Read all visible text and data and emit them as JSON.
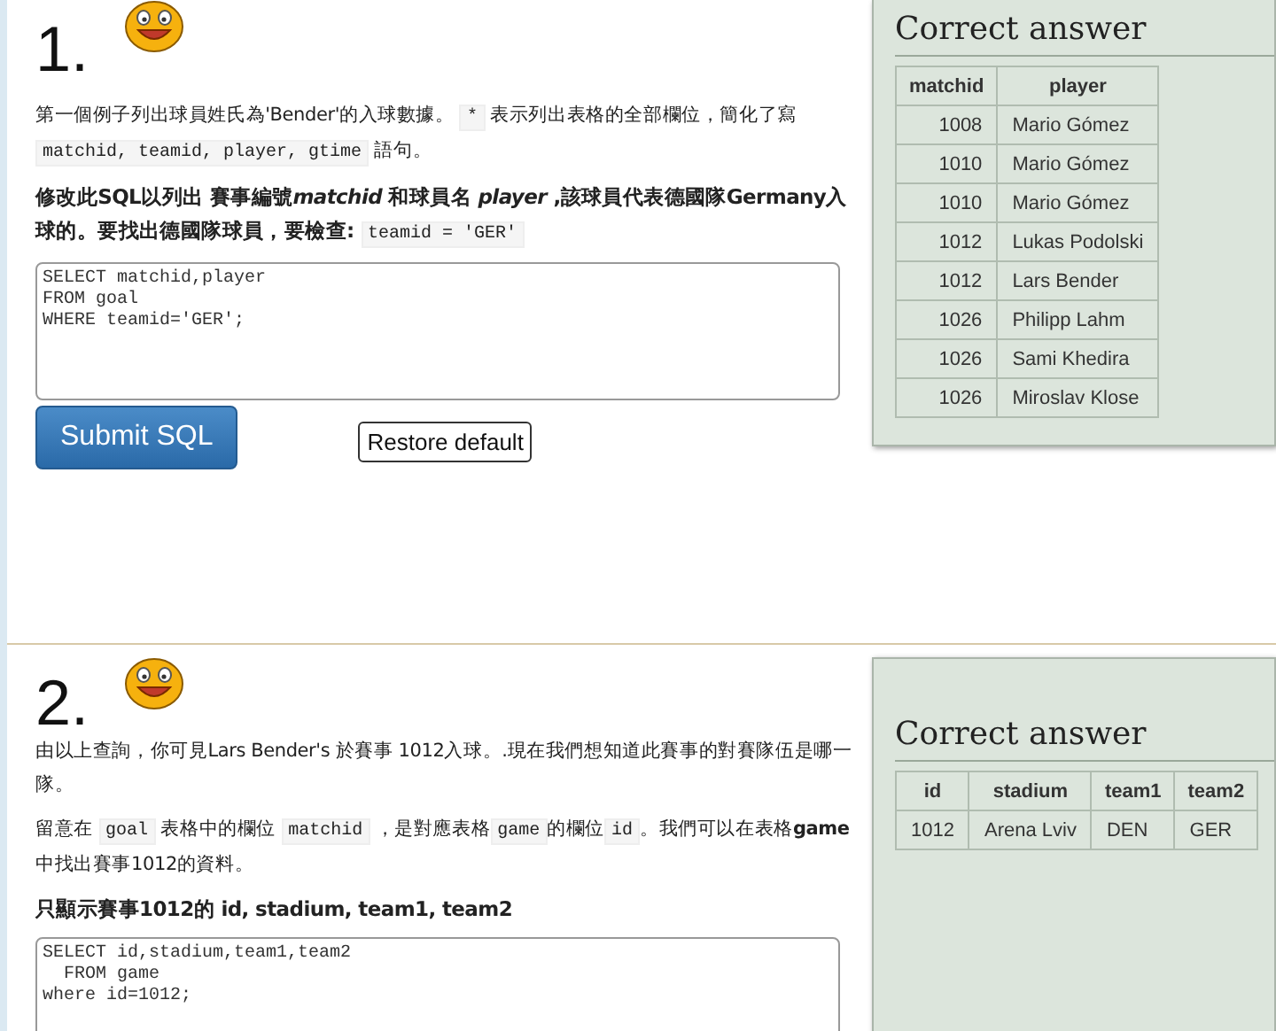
{
  "exercises": [
    {
      "number": "1.",
      "paragraphs": [
        {
          "kind": "normal",
          "parts": [
            {
              "kind": "text",
              "text": "第一個例子列出球員姓氏為'Bender'的入球數據。 "
            },
            {
              "kind": "code",
              "text": "*"
            },
            {
              "kind": "text",
              "text": " 表示列出表格的全部欄位，簡化了寫 "
            },
            {
              "kind": "code",
              "text": "matchid, teamid, player, gtime"
            },
            {
              "kind": "text",
              "text": " 語句。"
            }
          ]
        },
        {
          "kind": "bold",
          "parts": [
            {
              "kind": "text",
              "text": "修改此SQL以列出 賽事編號"
            },
            {
              "kind": "italic",
              "text": "matchid"
            },
            {
              "kind": "text",
              "text": " 和球員名 "
            },
            {
              "kind": "italic",
              "text": "player"
            },
            {
              "kind": "text",
              "text": " ,該球員代表德國隊Germany入球的。要找出德國隊球員，要檢查: "
            },
            {
              "kind": "code",
              "text": "teamid = 'GER'"
            }
          ]
        }
      ],
      "sql": "SELECT matchid,player\nFROM goal\nWHERE teamid='GER';",
      "buttons": [
        {
          "kind": "primary",
          "label": "Submit SQL"
        },
        {
          "kind": "plain",
          "label": "Restore default"
        }
      ],
      "answer": {
        "title": "Correct answer",
        "columns": [
          "matchid",
          "player"
        ],
        "rows": [
          [
            "1008",
            "Mario Gómez"
          ],
          [
            "1010",
            "Mario Gómez"
          ],
          [
            "1010",
            "Mario Gómez"
          ],
          [
            "1012",
            "Lukas Podolski"
          ],
          [
            "1012",
            "Lars Bender"
          ],
          [
            "1026",
            "Philipp Lahm"
          ],
          [
            "1026",
            "Sami Khedira"
          ],
          [
            "1026",
            "Miroslav Klose"
          ]
        ]
      }
    },
    {
      "number": "2.",
      "paragraphs": [
        {
          "kind": "normal",
          "parts": [
            {
              "kind": "text",
              "text": "由以上查詢，你可見Lars Bender's 於賽事 1012入球。.現在我們想知道此賽事的對賽隊伍是哪一隊。"
            }
          ]
        },
        {
          "kind": "normal",
          "parts": [
            {
              "kind": "text",
              "text": "留意在 "
            },
            {
              "kind": "code",
              "text": "goal"
            },
            {
              "kind": "text",
              "text": " 表格中的欄位 "
            },
            {
              "kind": "code",
              "text": "matchid"
            },
            {
              "kind": "text",
              "text": " ，是對應表格"
            },
            {
              "kind": "code",
              "text": "game"
            },
            {
              "kind": "text",
              "text": "的欄位"
            },
            {
              "kind": "code",
              "text": "id"
            },
            {
              "kind": "text",
              "text": "。我們可以在表格"
            },
            {
              "kind": "bold",
              "text": "game"
            },
            {
              "kind": "text",
              "text": "中找出賽事1012的資料。"
            }
          ]
        },
        {
          "kind": "bold",
          "parts": [
            {
              "kind": "text",
              "text": "只顯示賽事1012的 id, stadium, team1, team2"
            }
          ]
        }
      ],
      "sql": "SELECT id,stadium,team1,team2\n  FROM game\nwhere id=1012;",
      "answer": {
        "title": "Correct answer",
        "columns": [
          "id",
          "stadium",
          "team1",
          "team2"
        ],
        "rows": [
          [
            "1012",
            "Arena Lviv",
            "DEN",
            "GER"
          ]
        ]
      }
    }
  ]
}
